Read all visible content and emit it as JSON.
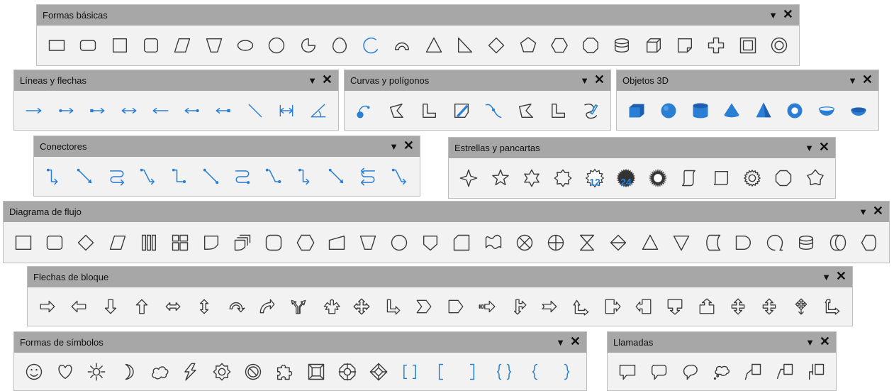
{
  "colors": {
    "icon": "#3a3a3a",
    "accent": "#2a7fd4",
    "title_bg": "#a7a7a7",
    "body_bg": "#f2f2f2"
  },
  "controls": {
    "menu_glyph": "▼",
    "close_glyph": "✕"
  },
  "toolbars": [
    {
      "id": "formas-basicas",
      "title": "Formas básicas",
      "tools": [
        "rectangle-icon",
        "rounded-rectangle-icon",
        "square-icon",
        "rounded-square-icon",
        "parallelogram-icon",
        "trapezoid-icon",
        "ellipse-icon",
        "circle-icon",
        "circle-pie-icon",
        "isosceles-triangle-icon",
        "block-arc-icon",
        "arc-icon",
        "triangle-icon",
        "right-triangle-icon",
        "diamond-icon",
        "pentagon-icon",
        "hexagon-icon",
        "octagon-icon",
        "cylinder-icon",
        "cube-icon",
        "folded-corner-icon",
        "cross-icon",
        "frame-icon",
        "ring-icon"
      ]
    },
    {
      "id": "lineas-flechas",
      "title": "Líneas y flechas",
      "tools": [
        "line-ends-arrow-icon",
        "line-circle-arrow-icon",
        "line-square-arrow-icon",
        "line-arrows-icon",
        "line-starts-arrow-icon",
        "line-arrow-circle-icon",
        "line-arrow-square-icon",
        "line-icon",
        "dimension-line-icon",
        "line-45-icon"
      ]
    },
    {
      "id": "curvas-poligonos",
      "title": "Curvas y polígonos",
      "tools": [
        "curve-filled-icon",
        "polygon-filled-icon",
        "polygon-45-filled-icon",
        "freeform-filled-icon",
        "curve-icon",
        "polygon-icon",
        "polygon-45-icon",
        "freeform-line-icon"
      ]
    },
    {
      "id": "objetos-3d",
      "title": "Objetos 3D",
      "tools": [
        "cube-3d-icon",
        "sphere-3d-icon",
        "cylinder-3d-icon",
        "cone-3d-icon",
        "pyramid-3d-icon",
        "torus-3d-icon",
        "shell-3d-icon",
        "half-sphere-3d-icon"
      ]
    },
    {
      "id": "conectores",
      "title": "Conectores",
      "tools": [
        "connector-icon",
        "straight-connector-icon",
        "curved-connector-icon",
        "line-connector-icon",
        "connector-circle-icon",
        "straight-connector-circle-icon",
        "curved-connector-circle-icon",
        "line-connector-circle-icon",
        "connector-arrow-icon",
        "straight-connector-arrow-icon",
        "curved-connector-arrow-icon",
        "line-connector-arrow-icon"
      ]
    },
    {
      "id": "estrellas-pancartas",
      "title": "Estrellas y pancartas",
      "tools": [
        "star4-icon",
        "star5-icon",
        "star6-icon",
        "star8-icon",
        "star12-icon",
        "star24-icon",
        "explosion-icon",
        "vertical-scroll-icon",
        "horizontal-scroll-icon",
        "signet-icon",
        "doorplate-icon",
        "concave-star-icon"
      ]
    },
    {
      "id": "diagrama-flujo",
      "title": "Diagrama de flujo",
      "tools": [
        "flowchart-process-icon",
        "flowchart-alternate-process-icon",
        "flowchart-decision-icon",
        "flowchart-data-icon",
        "flowchart-predefined-process-icon",
        "flowchart-internal-storage-icon",
        "flowchart-document-icon",
        "flowchart-multidocument-icon",
        "flowchart-terminator-icon",
        "flowchart-preparation-icon",
        "flowchart-manual-input-icon",
        "flowchart-manual-operation-icon",
        "flowchart-connector-icon",
        "flowchart-off-page-connector-icon",
        "flowchart-card-icon",
        "flowchart-punched-tape-icon",
        "flowchart-summing-junction-icon",
        "flowchart-or-icon",
        "flowchart-collate-icon",
        "flowchart-sort-icon",
        "flowchart-extract-icon",
        "flowchart-merge-icon",
        "flowchart-stored-data-icon",
        "flowchart-delay-icon",
        "flowchart-sequential-access-icon",
        "flowchart-magnetic-disc-icon",
        "flowchart-direct-access-icon",
        "flowchart-display-icon"
      ]
    },
    {
      "id": "flechas-bloque",
      "title": "Flechas de bloque",
      "tools": [
        "right-arrow-icon",
        "left-arrow-icon",
        "down-arrow-icon",
        "up-arrow-icon",
        "left-right-arrow-icon",
        "up-down-arrow-icon",
        "circular-arrow-icon",
        "curved-up-arrow-icon",
        "split-arrow-icon",
        "up-right-down-arrow-icon",
        "four-way-arrow-icon",
        "corner-right-arrow-icon",
        "chevron-icon",
        "pentagon-arrow-icon",
        "striped-right-arrow-icon",
        "up-right-arrow-callout-icon",
        "notched-right-arrow-icon",
        "up-right-arrow-icon",
        "right-arrow-callout-icon",
        "left-arrow-callout-icon",
        "down-arrow-callout-icon",
        "up-arrow-callout-icon",
        "up-down-arrow-callout-icon",
        "left-right-arrow-callout-icon",
        "four-way-arrow-callout-icon",
        "up-right-arrow-callout-2-icon"
      ]
    },
    {
      "id": "formas-simbolos",
      "title": "Formas de símbolos",
      "tools": [
        "smiley-icon",
        "heart-icon",
        "sun-icon",
        "moon-icon",
        "cloud-icon",
        "lightning-icon",
        "flower-icon",
        "prohibited-icon",
        "puzzle-icon",
        "bevel-square-icon",
        "octagon-bevel-icon",
        "diamond-bevel-icon",
        "double-bracket-icon",
        "left-bracket-icon",
        "right-bracket-icon",
        "double-brace-icon",
        "left-brace-icon",
        "right-brace-icon"
      ]
    },
    {
      "id": "llamadas",
      "title": "Llamadas",
      "tools": [
        "rectangular-callout-icon",
        "rounded-rectangular-callout-icon",
        "round-callout-icon",
        "cloud-callout-icon",
        "line-callout-1-icon",
        "line-callout-2-icon",
        "line-callout-3-icon"
      ]
    }
  ]
}
